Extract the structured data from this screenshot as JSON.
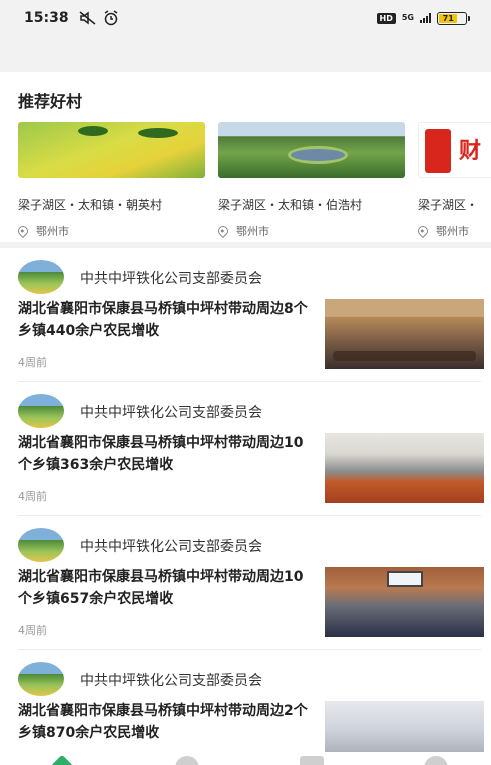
{
  "status_bar": {
    "time": "15:38",
    "hd": "HD",
    "network": "5G",
    "battery_level": "71",
    "battery_color": "#f1c40f"
  },
  "recommend": {
    "title": "推荐好村",
    "villages": [
      {
        "name": "梁子湖区・太和镇・朝英村",
        "location": "鄂州市"
      },
      {
        "name": "梁子湖区・太和镇・伯浩村",
        "location": "鄂州市"
      },
      {
        "name": "梁子湖区・",
        "location": "鄂州市",
        "image_text": "财"
      }
    ]
  },
  "news": [
    {
      "org": "中共中坪铁化公司支部委员会",
      "title": "湖北省襄阳市保康县马桥镇中坪村带动周边8个乡镇440余户农民增收",
      "time": "4周前"
    },
    {
      "org": "中共中坪铁化公司支部委员会",
      "title": "湖北省襄阳市保康县马桥镇中坪村带动周边10个乡镇363余户农民增收",
      "time": "4周前"
    },
    {
      "org": "中共中坪铁化公司支部委员会",
      "title": "湖北省襄阳市保康县马桥镇中坪村带动周边10个乡镇657余户农民增收",
      "time": "4周前"
    },
    {
      "org": "中共中坪铁化公司支部委员会",
      "title": "湖北省襄阳市保康县马桥镇中坪村带动周边2个乡镇870余户农民增收",
      "time": ""
    }
  ],
  "colors": {
    "accent": "#2fae6a",
    "background": "#f2f2f2"
  },
  "icons": [
    "mute-icon",
    "alarm-icon",
    "location-pin-icon",
    "home-tab-icon"
  ]
}
